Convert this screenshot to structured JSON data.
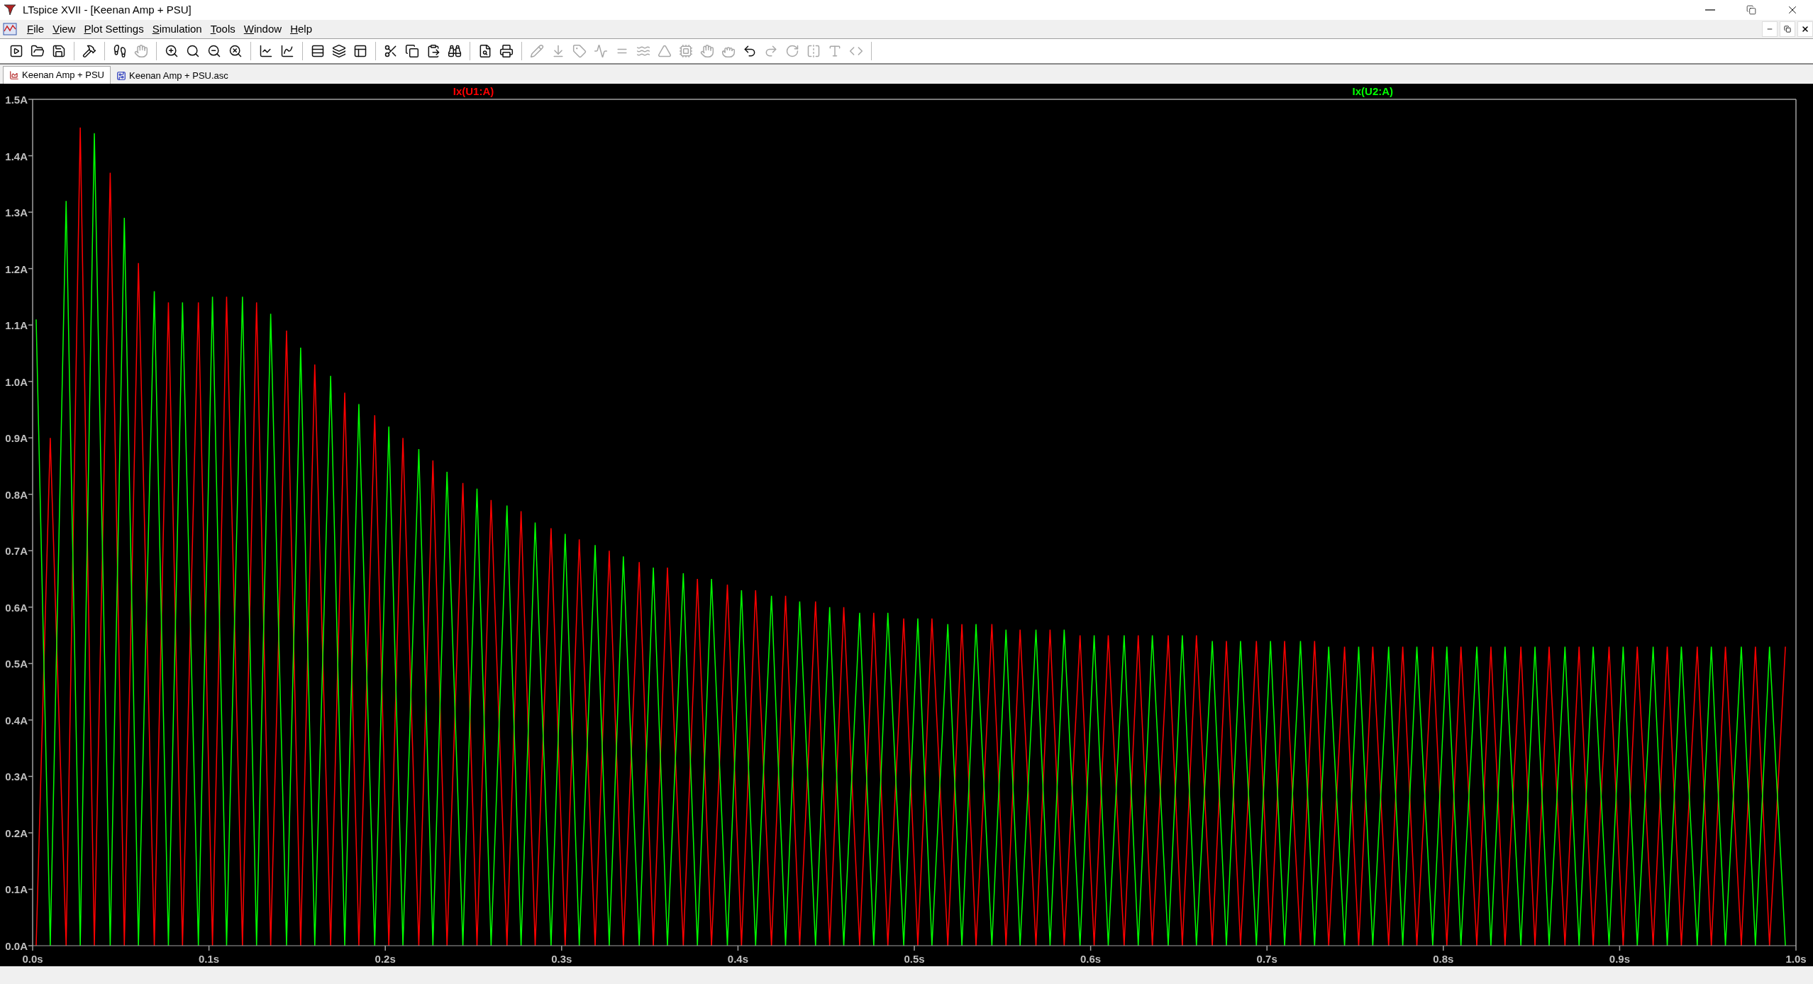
{
  "window": {
    "title": "LTspice XVII - [Keenan Amp + PSU]"
  },
  "menu": [
    "File",
    "View",
    "Plot Settings",
    "Simulation",
    "Tools",
    "Window",
    "Help"
  ],
  "toolbar": [
    [
      {
        "disabled": false
      },
      {
        "disabled": false
      },
      {
        "disabled": false
      }
    ],
    [
      {
        "disabled": false
      }
    ],
    [
      {
        "disabled": false
      },
      {
        "disabled": true
      }
    ],
    [
      {
        "disabled": false
      },
      {
        "disabled": false
      },
      {
        "disabled": false
      },
      {
        "disabled": false
      }
    ],
    [
      {
        "disabled": false
      },
      {
        "disabled": false
      }
    ],
    [
      {
        "disabled": false
      },
      {
        "disabled": false
      },
      {
        "disabled": false
      }
    ],
    [
      {
        "disabled": false
      },
      {
        "disabled": false
      },
      {
        "disabled": false
      },
      {
        "disabled": false
      }
    ],
    [
      {
        "disabled": false
      },
      {
        "disabled": false
      }
    ],
    [
      {
        "disabled": true
      },
      {
        "disabled": true
      },
      {
        "disabled": true
      },
      {
        "disabled": true
      },
      {
        "disabled": true
      },
      {
        "disabled": true
      },
      {
        "disabled": true
      },
      {
        "disabled": true
      },
      {
        "disabled": true
      },
      {
        "disabled": true
      },
      {
        "disabled": false
      },
      {
        "disabled": true
      },
      {
        "disabled": true
      },
      {
        "disabled": true
      },
      {
        "disabled": true
      },
      {
        "disabled": true
      }
    ]
  ],
  "tabs": [
    {
      "label": "Keenan Amp + PSU",
      "kind": "plot",
      "selected": true
    },
    {
      "label": "Keenan Amp + PSU.asc",
      "kind": "schematic",
      "selected": false
    }
  ],
  "plot": {
    "chart_data": {
      "type": "line",
      "x": [
        0.002,
        0.01,
        0.019,
        0.027,
        0.035,
        0.044,
        0.052,
        0.06,
        0.069,
        0.077,
        0.085,
        0.094,
        0.102,
        0.11,
        0.119,
        0.127,
        0.135,
        0.144,
        0.152,
        0.16,
        0.169,
        0.177,
        0.185,
        0.194,
        0.202,
        0.21,
        0.219,
        0.227,
        0.235,
        0.244,
        0.252,
        0.26,
        0.269,
        0.277,
        0.285,
        0.294,
        0.302,
        0.31,
        0.319,
        0.327,
        0.335,
        0.344,
        0.352,
        0.36,
        0.369,
        0.377,
        0.385,
        0.394,
        0.402,
        0.41,
        0.419,
        0.427,
        0.435,
        0.444,
        0.452,
        0.46,
        0.469,
        0.477,
        0.485,
        0.494,
        0.502,
        0.51,
        0.519,
        0.527,
        0.535,
        0.544,
        0.552,
        0.56,
        0.569,
        0.577,
        0.585,
        0.594,
        0.602,
        0.61,
        0.619,
        0.627,
        0.635,
        0.644,
        0.652,
        0.66,
        0.669,
        0.677,
        0.685,
        0.694,
        0.702,
        0.71,
        0.719,
        0.727,
        0.735,
        0.744,
        0.752,
        0.76,
        0.769,
        0.777,
        0.785,
        0.794,
        0.802,
        0.81,
        0.819,
        0.827,
        0.835,
        0.844,
        0.852,
        0.86,
        0.869,
        0.877,
        0.885,
        0.894,
        0.902,
        0.91,
        0.919,
        0.927,
        0.935,
        0.944,
        0.952,
        0.96,
        0.969,
        0.977,
        0.985,
        0.994
      ],
      "series": [
        {
          "name": "Ix(U1:A)",
          "color": "#ff0000",
          "values": [
            0,
            0.9,
            0,
            1.45,
            0,
            1.37,
            0,
            1.21,
            0,
            1.14,
            0,
            1.14,
            0,
            1.15,
            0,
            1.14,
            0,
            1.09,
            0,
            1.03,
            0,
            0.98,
            0,
            0.94,
            0,
            0.9,
            0,
            0.86,
            0,
            0.82,
            0,
            0.79,
            0,
            0.77,
            0,
            0.74,
            0,
            0.72,
            0,
            0.7,
            0,
            0.68,
            0,
            0.67,
            0,
            0.65,
            0,
            0.64,
            0,
            0.63,
            0,
            0.62,
            0,
            0.61,
            0,
            0.6,
            0,
            0.59,
            0,
            0.58,
            0,
            0.58,
            0,
            0.57,
            0,
            0.57,
            0,
            0.56,
            0,
            0.56,
            0,
            0.55,
            0,
            0.55,
            0,
            0.55,
            0,
            0.55,
            0,
            0.55,
            0,
            0.54,
            0,
            0.54,
            0,
            0.54,
            0,
            0.54,
            0,
            0.53,
            0,
            0.53,
            0,
            0.53,
            0,
            0.53,
            0,
            0.53,
            0,
            0.53,
            0,
            0.53,
            0,
            0.53,
            0,
            0.53,
            0,
            0.53,
            0,
            0.53,
            0,
            0.53,
            0,
            0.53,
            0,
            0.53,
            0,
            0.53,
            0,
            0.53
          ]
        },
        {
          "name": "Ix(U2:A)",
          "color": "#00ff00",
          "values": [
            1.11,
            0,
            1.32,
            0,
            1.44,
            0,
            1.29,
            0,
            1.16,
            0,
            1.14,
            0,
            1.15,
            0,
            1.15,
            0,
            1.12,
            0,
            1.06,
            0,
            1.01,
            0,
            0.96,
            0,
            0.92,
            0,
            0.88,
            0,
            0.84,
            0,
            0.81,
            0,
            0.78,
            0,
            0.75,
            0,
            0.73,
            0,
            0.71,
            0,
            0.69,
            0,
            0.67,
            0,
            0.66,
            0,
            0.65,
            0,
            0.63,
            0,
            0.62,
            0,
            0.61,
            0,
            0.6,
            0,
            0.59,
            0,
            0.59,
            0,
            0.58,
            0,
            0.57,
            0,
            0.57,
            0,
            0.56,
            0,
            0.56,
            0,
            0.56,
            0,
            0.55,
            0,
            0.55,
            0,
            0.55,
            0,
            0.55,
            0,
            0.54,
            0,
            0.54,
            0,
            0.54,
            0,
            0.54,
            0,
            0.53,
            0,
            0.53,
            0,
            0.53,
            0,
            0.53,
            0,
            0.53,
            0,
            0.53,
            0,
            0.53,
            0,
            0.53,
            0,
            0.53,
            0,
            0.53,
            0,
            0.53,
            0,
            0.53,
            0,
            0.53,
            0,
            0.53,
            0,
            0.53,
            0,
            0.53,
            0
          ]
        }
      ],
      "xlim": [
        0,
        1
      ],
      "ylim": [
        0,
        1.5
      ],
      "xticks": [
        {
          "value": 0,
          "label": "0.0s"
        },
        {
          "value": 0.1,
          "label": "0.1s"
        },
        {
          "value": 0.2,
          "label": "0.2s"
        },
        {
          "value": 0.3,
          "label": "0.3s"
        },
        {
          "value": 0.4,
          "label": "0.4s"
        },
        {
          "value": 0.5,
          "label": "0.5s"
        },
        {
          "value": 0.6,
          "label": "0.6s"
        },
        {
          "value": 0.7,
          "label": "0.7s"
        },
        {
          "value": 0.8,
          "label": "0.8s"
        },
        {
          "value": 0.9,
          "label": "0.9s"
        },
        {
          "value": 1.0,
          "label": "1.0s"
        }
      ],
      "yticks": [
        {
          "value": 0,
          "label": "0.0A"
        },
        {
          "value": 0.1,
          "label": "0.1A"
        },
        {
          "value": 0.2,
          "label": "0.2A"
        },
        {
          "value": 0.3,
          "label": "0.3A"
        },
        {
          "value": 0.4,
          "label": "0.4A"
        },
        {
          "value": 0.5,
          "label": "0.5A"
        },
        {
          "value": 0.6,
          "label": "0.6A"
        },
        {
          "value": 0.7,
          "label": "0.7A"
        },
        {
          "value": 0.8,
          "label": "0.8A"
        },
        {
          "value": 0.9,
          "label": "0.9A"
        },
        {
          "value": 1.0,
          "label": "1.0A"
        },
        {
          "value": 1.1,
          "label": "1.1A"
        },
        {
          "value": 1.2,
          "label": "1.2A"
        },
        {
          "value": 1.3,
          "label": "1.3A"
        },
        {
          "value": 1.4,
          "label": "1.4A"
        },
        {
          "value": 1.5,
          "label": "1.5A"
        }
      ]
    }
  }
}
